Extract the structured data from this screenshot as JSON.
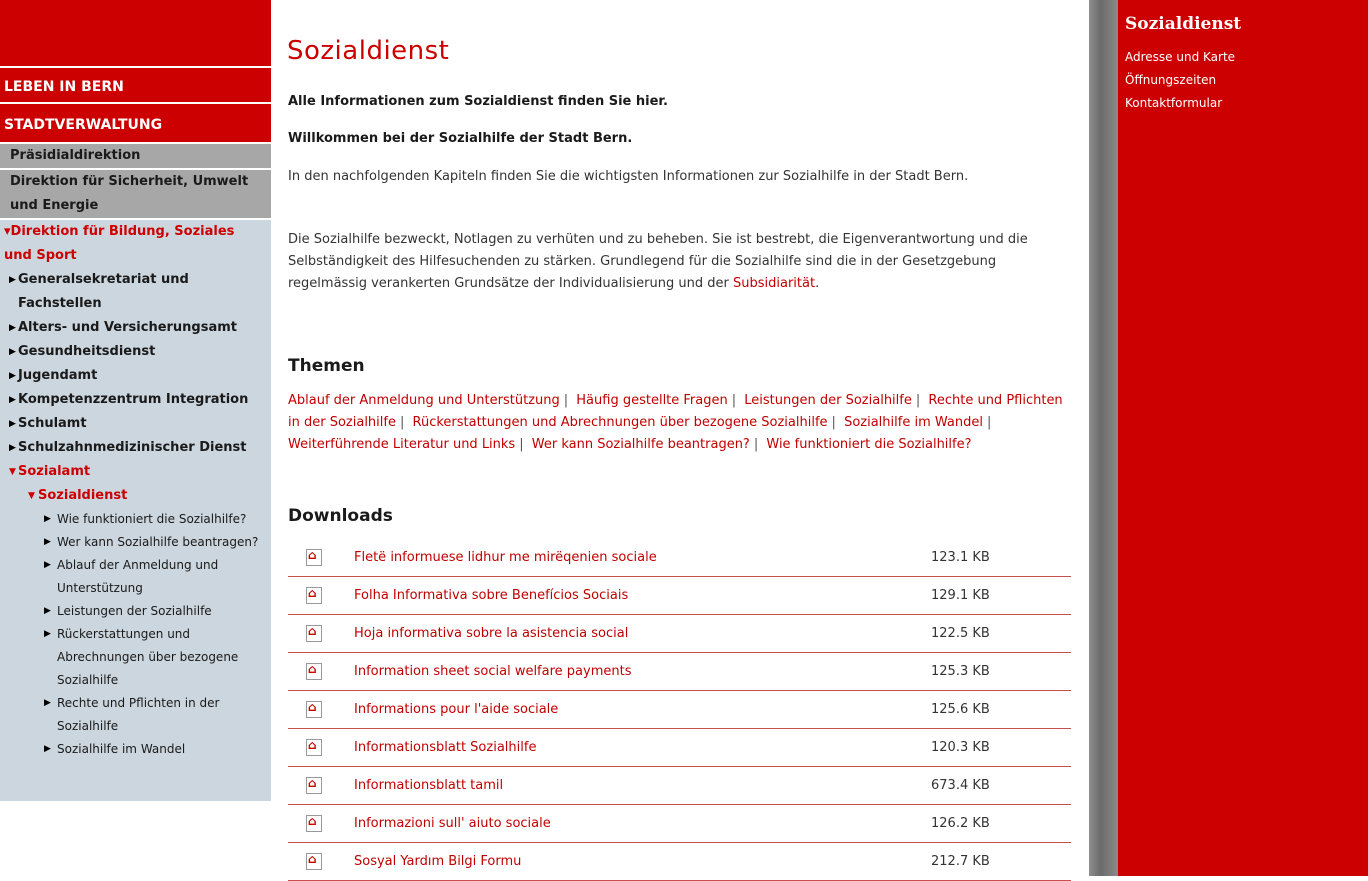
{
  "left_nav": {
    "sections": [
      "LEBEN IN BERN",
      "STADTVERWALTUNG"
    ],
    "directorates": [
      {
        "label": "Präsidialdirektion"
      },
      {
        "label": "Direktion für Sicherheit, Umwelt und Energie"
      }
    ],
    "active_directorate": "Direktion für Bildung, Soziales und Sport",
    "offices": [
      "Generalsekretariat und Fachstellen",
      "Alters- und Versicherungsamt",
      "Gesundheitsdienst",
      "Jugendamt",
      "Kompetenzzentrum Integration",
      "Schulamt",
      "Schulzahnmedizinischer Dienst"
    ],
    "active_office": "Sozialamt",
    "active_sub": "Sozialdienst",
    "leaves": [
      "Wie funktioniert die Sozialhilfe?",
      "Wer kann Sozialhilfe beantragen?",
      "Ablauf der Anmeldung und Unterstützung",
      "Leistungen der Sozialhilfe",
      "Rückerstattungen und Abrechnungen über bezogene Sozialhilfe",
      "Rechte und Pflichten in der Sozialhilfe",
      "Sozialhilfe im Wandel"
    ]
  },
  "main": {
    "title": "Sozialdienst",
    "lead1": "Alle Informationen zum Sozialdienst finden Sie hier.",
    "lead2": "Willkommen bei der Sozialhilfe der Stadt Bern.",
    "para1": "In den nachfolgenden Kapiteln finden Sie die wichtigsten Informationen zur Sozialhilfe in der Stadt Bern.",
    "para2_text": "Die Sozialhilfe bezweckt, Notlagen zu verhüten und zu beheben. Sie ist bestrebt, die Eigenverantwortung und die Selbständigkeit des Hilfesuchenden zu stärken. Grundlegend für die Sozialhilfe sind die in der Gesetzgebung regelmässig verankerten Grundsätze der Individualisierung und der ",
    "para2_link": "Subsidiarität",
    "para2_end": ".",
    "themes_heading": "Themen",
    "themes": [
      "Ablauf der Anmeldung und Unterstützung",
      "Häufig gestellte Fragen",
      "Leistungen der Sozialhilfe",
      "Rechte und Pflichten in der Sozialhilfe",
      "Rückerstattungen und Abrechnungen über bezogene Sozialhilfe",
      "Sozialhilfe im Wandel",
      "Weiterführende Literatur und Links",
      "Wer kann Sozialhilfe beantragen?",
      "Wie funktioniert die Sozialhilfe?"
    ],
    "theme_separator": "|",
    "downloads_heading": "Downloads",
    "downloads": [
      {
        "name": "Fletë informuese lidhur me mirëqenien sociale",
        "size": "123.1 KB"
      },
      {
        "name": "Folha Informativa sobre Benefícios Sociais",
        "size": "129.1 KB"
      },
      {
        "name": "Hoja informativa sobre la asistencia social",
        "size": "122.5 KB"
      },
      {
        "name": "Information sheet social welfare payments",
        "size": "125.3 KB"
      },
      {
        "name": "Informations pour l'aide sociale",
        "size": "125.6 KB"
      },
      {
        "name": "Informationsblatt Sozialhilfe",
        "size": "120.3 KB"
      },
      {
        "name": "Informationsblatt tamil",
        "size": "673.4 KB"
      },
      {
        "name": "Informazioni sull' aiuto sociale",
        "size": "126.2 KB"
      },
      {
        "name": "Sosyal Yardım Bilgi Formu",
        "size": "212.7 KB"
      }
    ]
  },
  "right_panel": {
    "title": "Sozialdienst",
    "links": [
      "Adresse und Karte",
      "Öffnungszeiten",
      "Kontaktformular"
    ]
  },
  "colors": {
    "brand_red": "#cc0000",
    "nav_gray": "#a7a7a7",
    "nav_light": "#ccd6de"
  },
  "icons": {
    "nav_arrow": "arrow-right-icon",
    "nav_arrow_open": "arrow-down-icon",
    "download_icon": "pdf-icon"
  }
}
